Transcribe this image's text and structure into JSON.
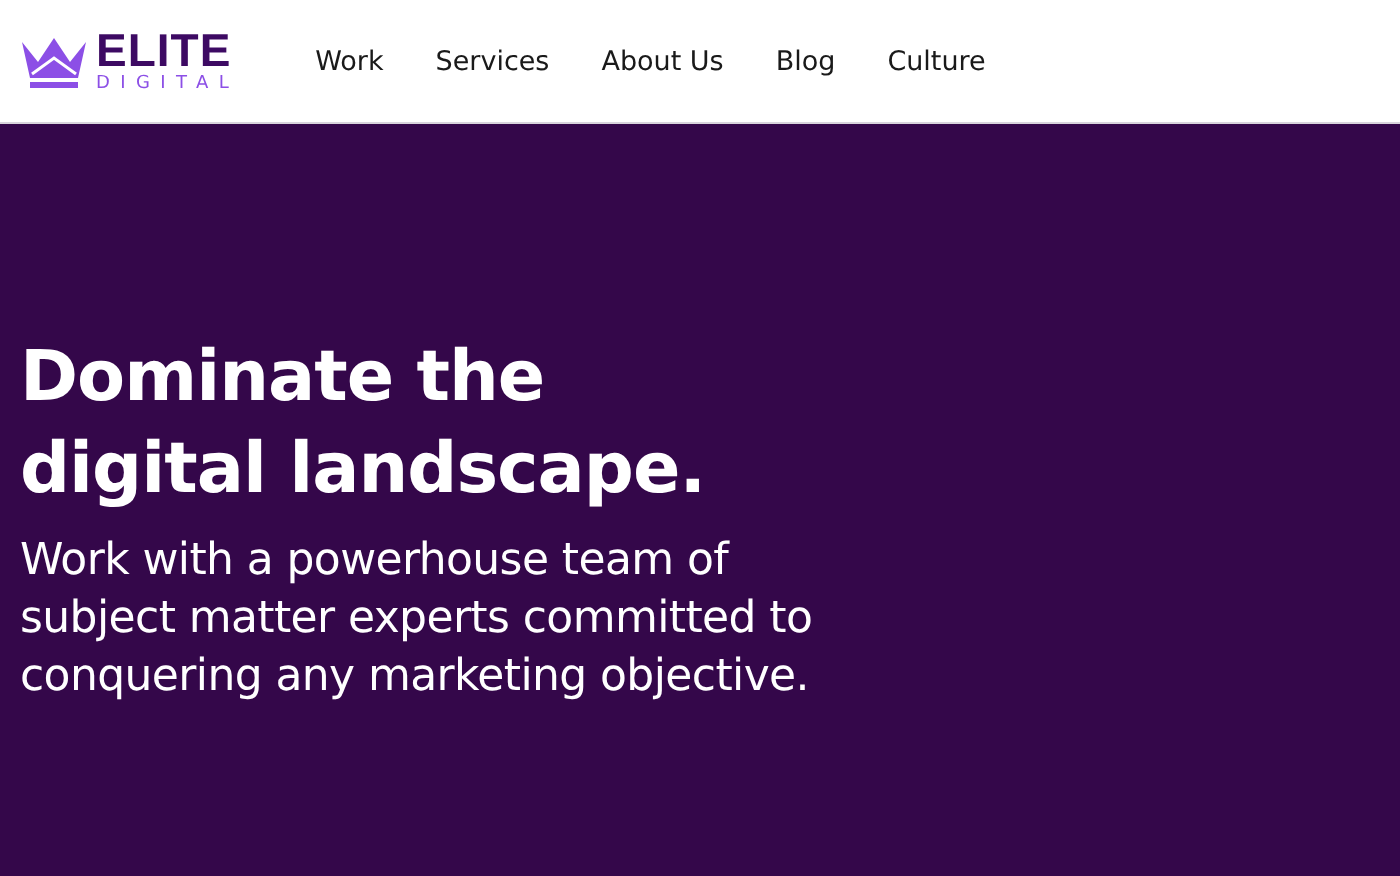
{
  "logo": {
    "name": "ELITE",
    "tagline": "DIGITAL"
  },
  "nav": [
    "Work",
    "Services",
    "About Us",
    "Blog",
    "Culture"
  ],
  "hero": {
    "headline_lines": [
      "Dominate the",
      "digital landscape."
    ],
    "subtitle_lines": [
      "Work with a powerhouse team of",
      "subject matter experts committed to",
      "conquering any marketing objective."
    ]
  }
}
